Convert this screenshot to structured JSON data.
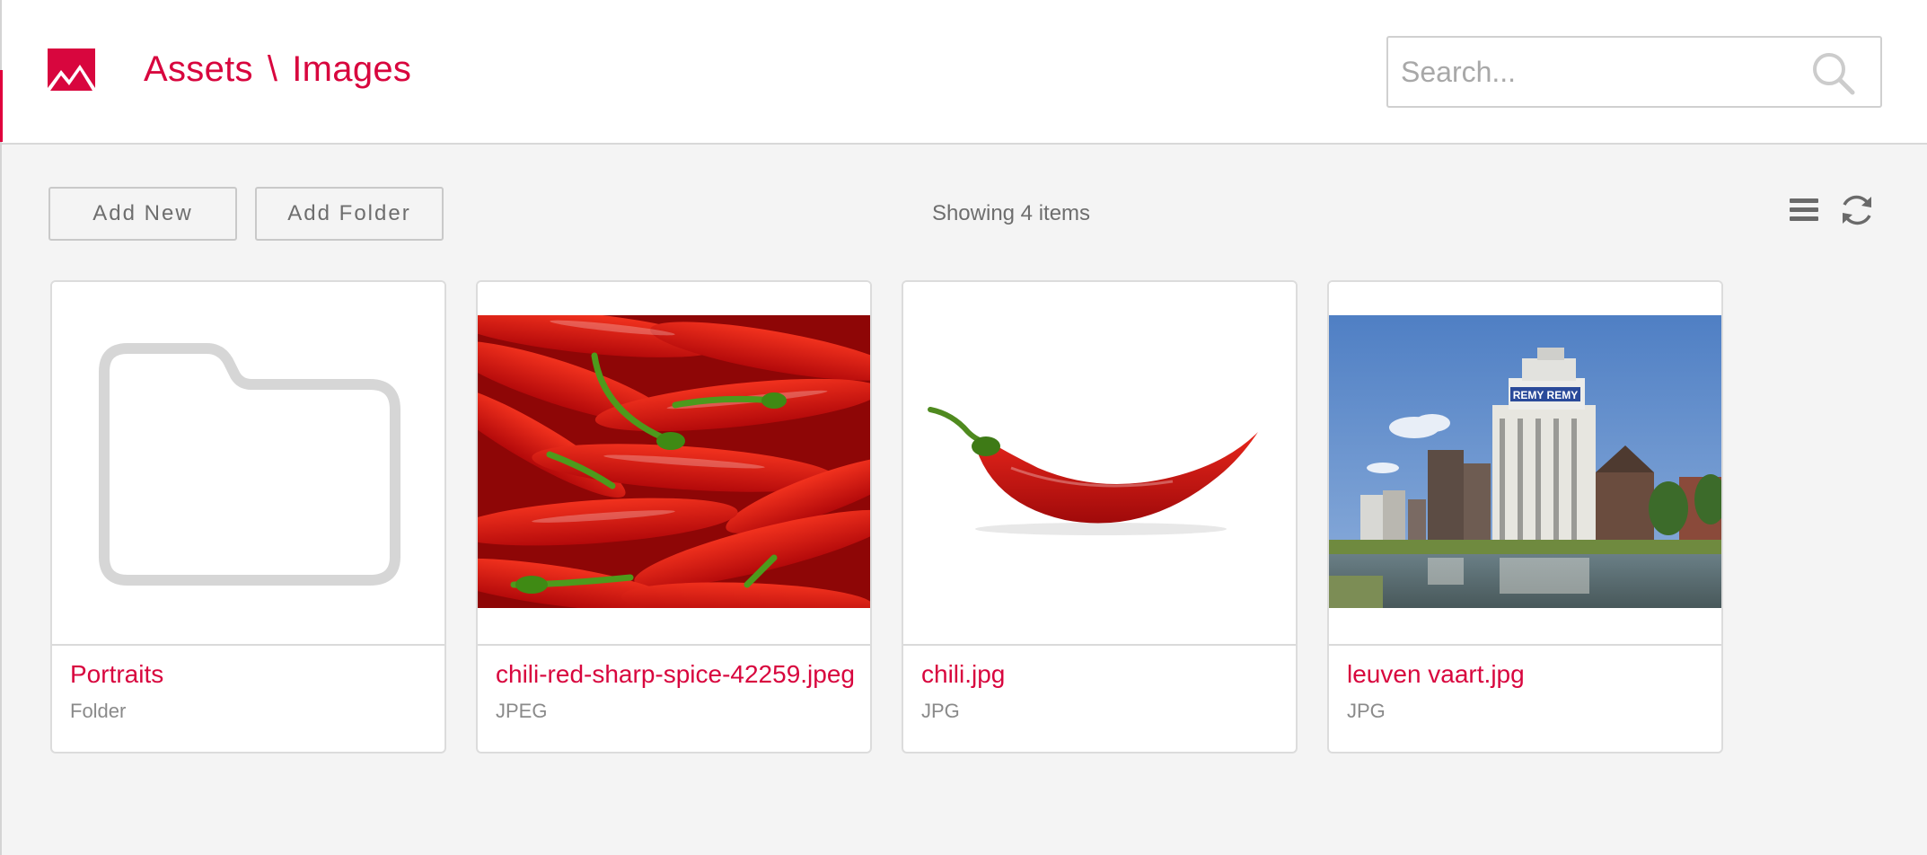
{
  "header": {
    "breadcrumb_root": "Assets",
    "breadcrumb_separator": "\\",
    "breadcrumb_current": "Images",
    "logo_icon": "image-icon",
    "accent_color": "#d8063e"
  },
  "search": {
    "placeholder": "Search...",
    "value": "",
    "icon": "search-icon"
  },
  "toolbar": {
    "add_new_label": "Add New",
    "add_folder_label": "Add Folder",
    "item_count_text": "Showing 4 items",
    "list_view_icon": "list-view-icon",
    "refresh_icon": "refresh-icon"
  },
  "items": [
    {
      "name": "Portraits",
      "type": "Folder",
      "thumbnail": "folder-icon"
    },
    {
      "name": "chili-red-sharp-spice-42259.jpeg",
      "type": "JPEG",
      "thumbnail": "red-chilies-photo"
    },
    {
      "name": "chili.jpg",
      "type": "JPG",
      "thumbnail": "single-chili-photo"
    },
    {
      "name": "leuven vaart.jpg",
      "type": "JPG",
      "thumbnail": "canal-buildings-photo"
    }
  ]
}
